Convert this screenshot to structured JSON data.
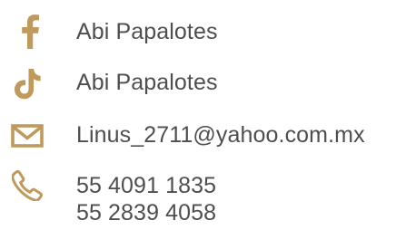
{
  "accent_color": "#bf9a5c",
  "text_color": "#4e4e4e",
  "contacts": {
    "facebook": {
      "icon": "facebook-icon",
      "label": "Abi Papalotes"
    },
    "tiktok": {
      "icon": "tiktok-icon",
      "label": "Abi Papalotes"
    },
    "email": {
      "icon": "mail-icon",
      "label": "Linus_2711@yahoo.com.mx"
    },
    "phone": {
      "icon": "phone-icon",
      "numbers": [
        "55 4091 1835",
        "55 2839 4058"
      ]
    }
  }
}
